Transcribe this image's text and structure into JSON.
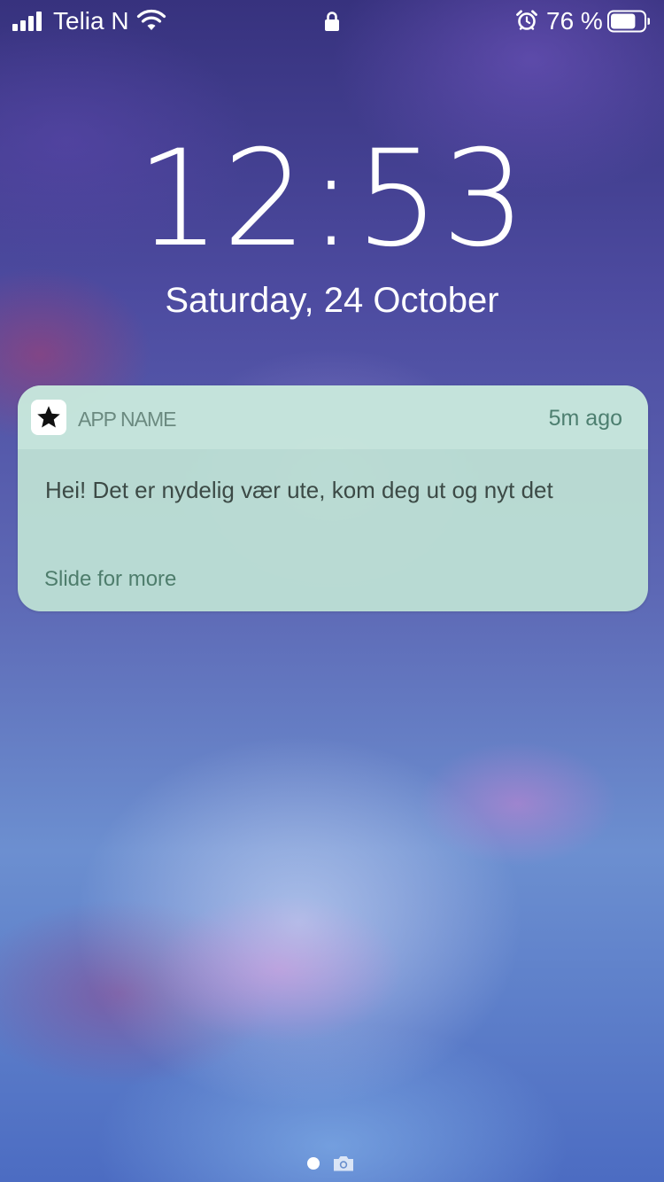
{
  "status_bar": {
    "carrier": "Telia N",
    "battery_percent": "76 %",
    "battery_level": 0.76,
    "signal_bars": 4,
    "icons": [
      "signal-icon",
      "wifi-icon",
      "lock-icon",
      "alarm-icon",
      "battery-icon"
    ]
  },
  "lock_screen": {
    "time": "12:53",
    "date": "Saturday, 24 October"
  },
  "notification": {
    "app_icon": "star-icon",
    "app_name": "APP NAME",
    "time_ago": "5m ago",
    "message": "Hei! Det er nydelig vær ute, kom deg ut og nyt det",
    "action_hint": "Slide for more"
  },
  "page_indicator": {
    "pages": 1,
    "current": 1,
    "extra_icon": "camera-icon"
  },
  "colors": {
    "notification_background": "#bee1d4",
    "notification_accent": "#4e7d6c",
    "text_on_wallpaper": "#ffffff"
  }
}
